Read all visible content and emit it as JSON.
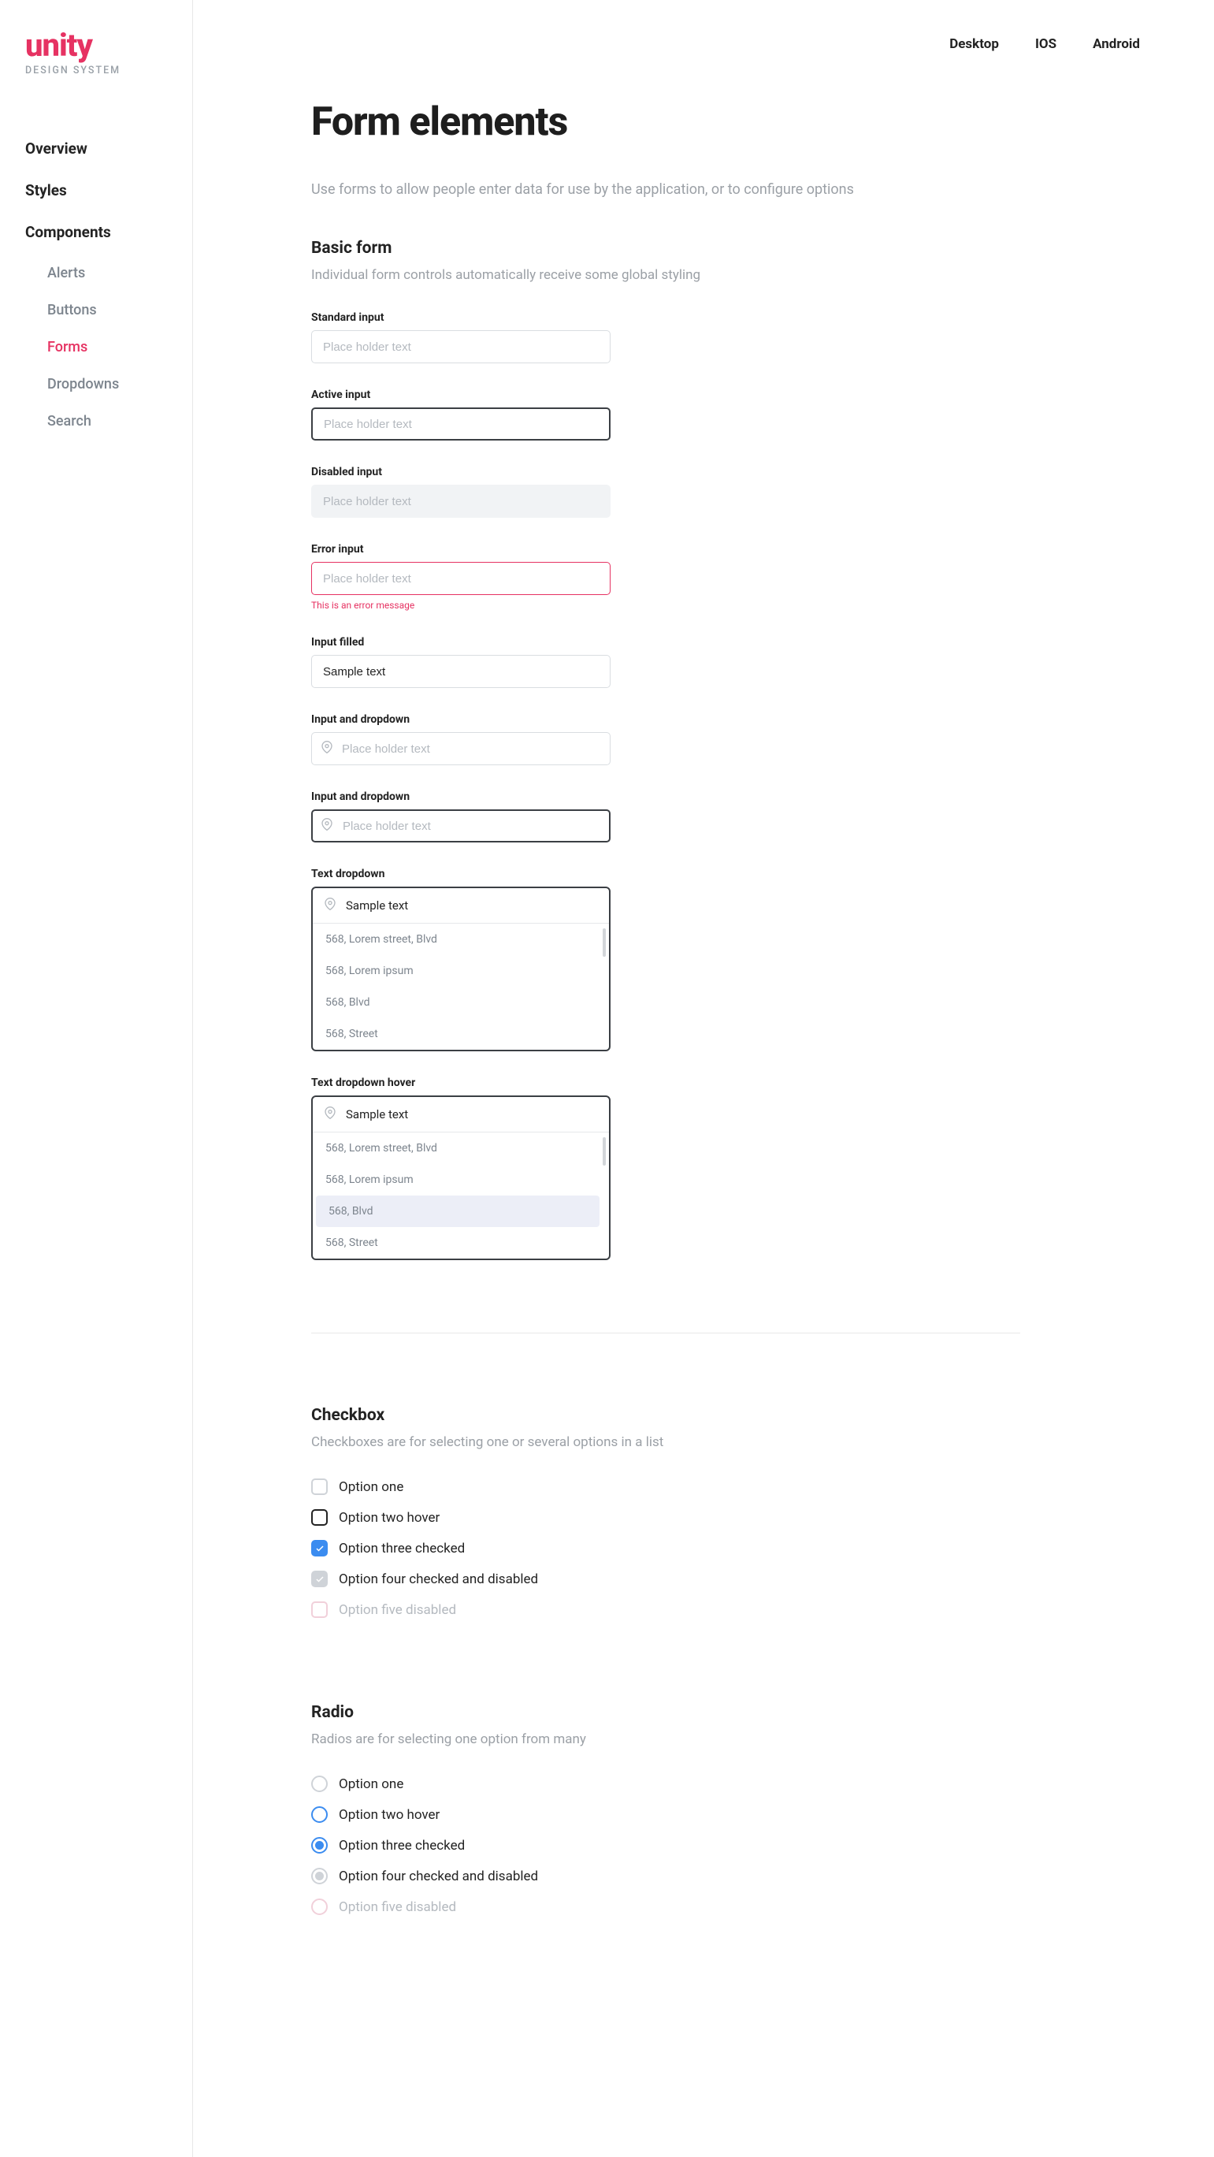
{
  "logo": {
    "title": "unity",
    "subtitle": "DESIGN SYSTEM"
  },
  "nav": {
    "overview": "Overview",
    "styles": "Styles",
    "components": "Components",
    "sub": {
      "alerts": "Alerts",
      "buttons": "Buttons",
      "forms": "Forms",
      "dropdowns": "Dropdowns",
      "search": "Search"
    }
  },
  "tabs": {
    "desktop": "Desktop",
    "ios": "IOS",
    "android": "Android"
  },
  "page": {
    "title": "Form elements",
    "desc": "Use forms to allow people enter data for use by the application, or to configure options"
  },
  "basic": {
    "title": "Basic form",
    "desc": "Individual form controls automatically receive some global styling",
    "standard": {
      "label": "Standard input",
      "placeholder": "Place holder text"
    },
    "active": {
      "label": "Active input",
      "placeholder": "Place holder text"
    },
    "disabled": {
      "label": "Disabled input",
      "placeholder": "Place holder text"
    },
    "error": {
      "label": "Error input",
      "placeholder": "Place holder text",
      "msg": "This is an error message"
    },
    "filled": {
      "label": "Input filled",
      "value": "Sample text"
    },
    "inputdd1": {
      "label": "Input and dropdown",
      "placeholder": "Place holder text"
    },
    "inputdd2": {
      "label": "Input and dropdown",
      "placeholder": "Place holder text"
    },
    "textdd": {
      "label": "Text dropdown",
      "value": "Sample text",
      "items": [
        "568, Lorem street, Blvd",
        "568, Lorem ipsum",
        "568, Blvd",
        "568, Street"
      ]
    },
    "textddhover": {
      "label": "Text dropdown hover",
      "value": "Sample text",
      "items": [
        "568, Lorem street, Blvd",
        "568, Lorem ipsum",
        "568, Blvd",
        "568, Street"
      ]
    }
  },
  "checkbox": {
    "title": "Checkbox",
    "desc": "Checkboxes are for selecting one or several options in a list",
    "opt1": "Option one",
    "opt2": "Option two hover",
    "opt3": "Option three checked",
    "opt4": "Option four checked and disabled",
    "opt5": "Option five disabled"
  },
  "radio": {
    "title": "Radio",
    "desc": "Radios are for selecting one option from many",
    "opt1": "Option one",
    "opt2": "Option two hover",
    "opt3": "Option three checked",
    "opt4": "Option four checked and disabled",
    "opt5": "Option five disabled"
  }
}
